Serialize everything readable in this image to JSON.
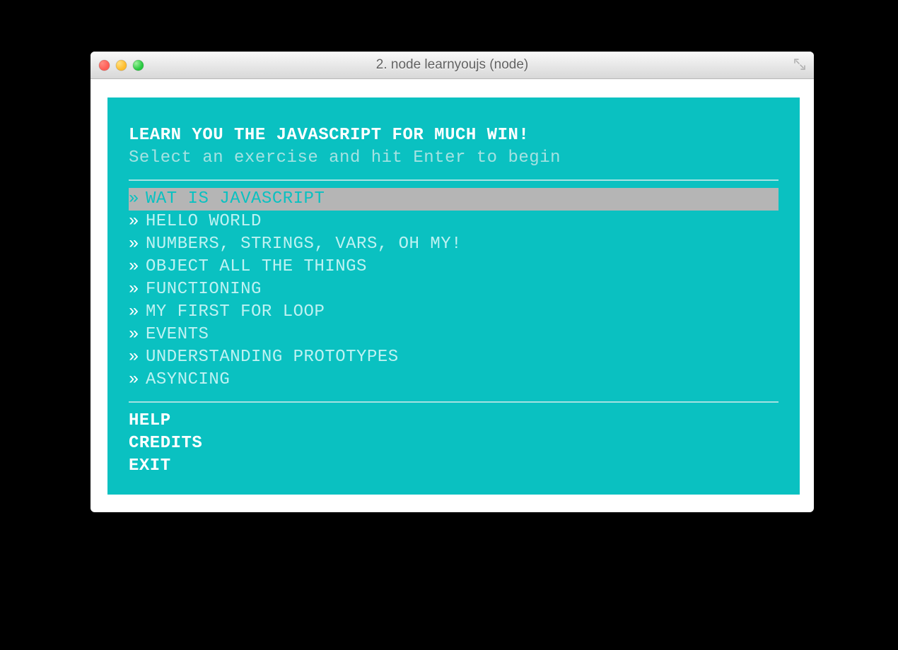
{
  "window": {
    "title": "2. node learnyoujs (node)"
  },
  "header": {
    "title": "LEARN YOU THE JAVASCRIPT FOR MUCH WIN!",
    "subtitle": "Select an exercise and hit Enter to begin"
  },
  "menu": {
    "bullet": "»",
    "selected_index": 0,
    "items": [
      "WAT IS JAVASCRIPT",
      "HELLO WORLD",
      "NUMBERS, STRINGS, VARS, OH MY!",
      "OBJECT ALL THE THINGS",
      "FUNCTIONING",
      "MY FIRST FOR LOOP",
      "EVENTS",
      "UNDERSTANDING PROTOTYPES",
      "ASYNCING"
    ]
  },
  "footer": {
    "items": [
      "HELP",
      "CREDITS",
      "EXIT"
    ]
  },
  "colors": {
    "terminal_bg": "#0ac1c1",
    "selected_bg": "#b5b5b5",
    "accent_text": "#ffffff"
  }
}
